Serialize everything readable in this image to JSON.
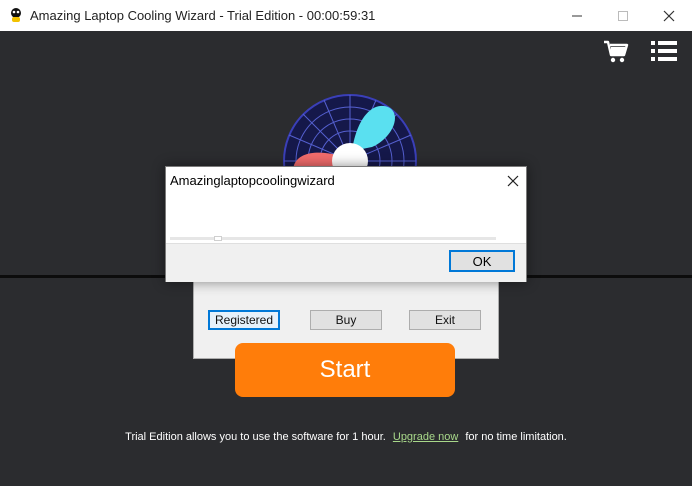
{
  "window": {
    "title": "Amazing Laptop Cooling Wizard - Trial Edition - 00:00:59:31",
    "controls": [
      "minimize-icon",
      "maximize-icon",
      "close-icon"
    ]
  },
  "toolbar": {
    "icons": [
      "cart-icon",
      "menu-list-icon"
    ]
  },
  "background_dialog": {
    "buttons": {
      "registered": "Registered",
      "buy": "Buy",
      "exit": "Exit"
    }
  },
  "main": {
    "start_label": "Start",
    "footer": {
      "text_before": "Trial Edition allows you to use the software for 1 hour.",
      "link": "Upgrade now",
      "text_after": "for no time limitation."
    }
  },
  "message_box": {
    "title": "Amazinglaptopcoolingwizard",
    "progress_fraction": 0.0,
    "ok_label": "OK"
  },
  "colors": {
    "background": "#2b2c2f",
    "start_button": "#ff7d0a",
    "link": "#a8d88a",
    "accent": "#0078d7"
  }
}
